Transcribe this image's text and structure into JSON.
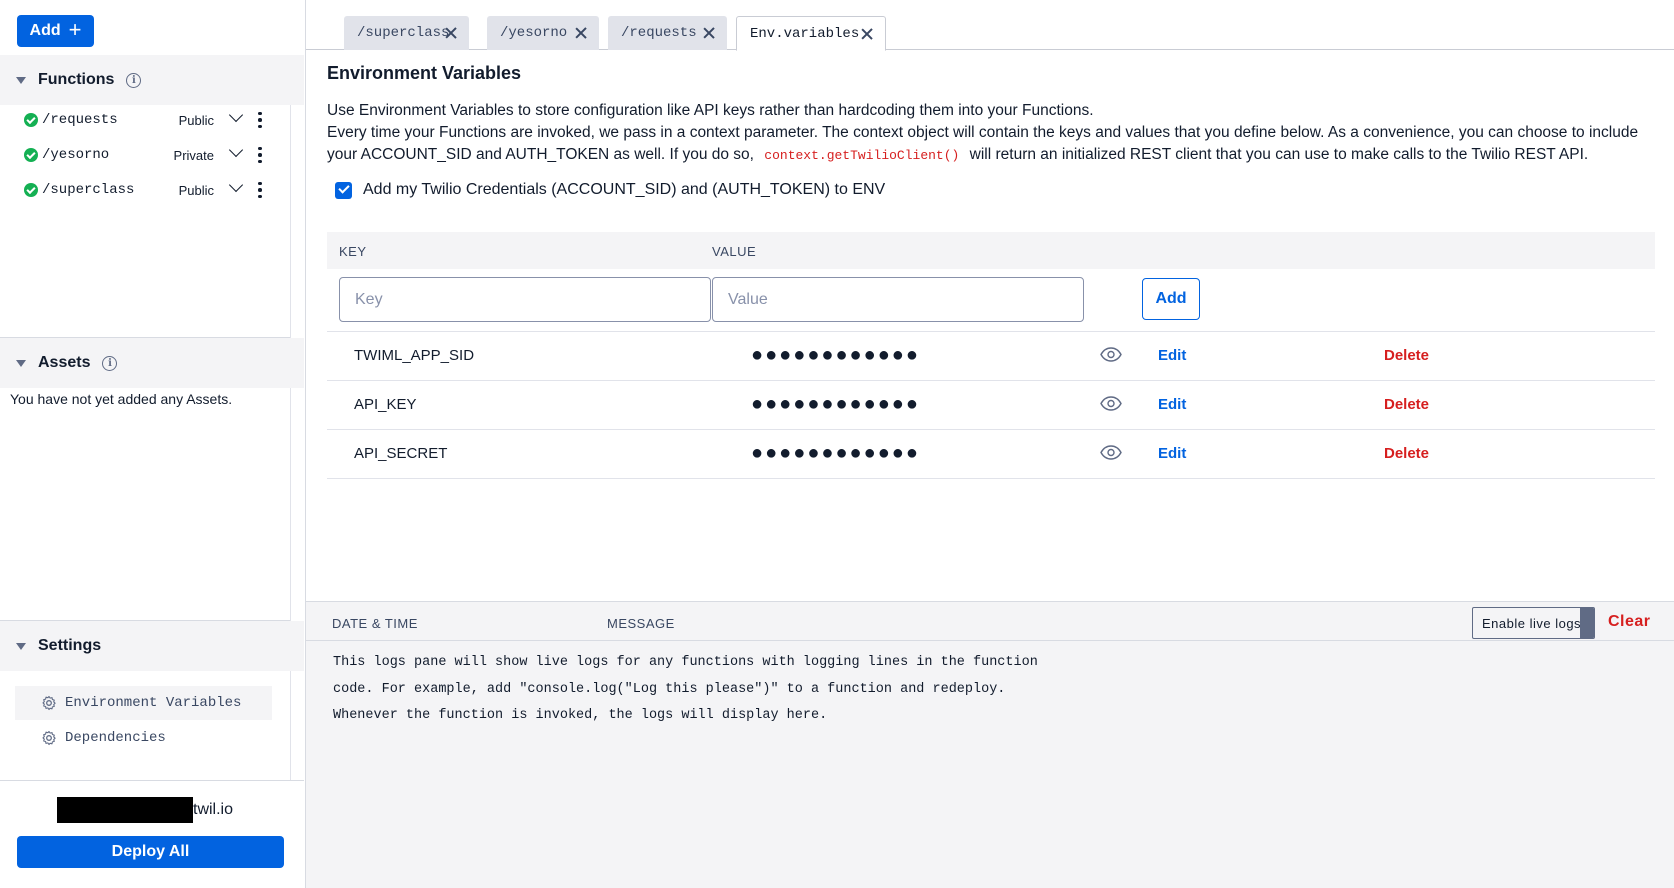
{
  "header": {
    "add_label": "Add"
  },
  "functions_section": {
    "title": "Functions",
    "items": [
      {
        "path": "/requests",
        "visibility": "Public"
      },
      {
        "path": "/yesorno",
        "visibility": "Private"
      },
      {
        "path": "/superclass",
        "visibility": "Public"
      }
    ]
  },
  "assets_section": {
    "title": "Assets",
    "empty_text": "You have not yet added any Assets."
  },
  "settings_section": {
    "title": "Settings",
    "items": [
      {
        "label": "Environment Variables",
        "active": true
      },
      {
        "label": "Dependencies",
        "active": false
      }
    ]
  },
  "footer": {
    "domain_suffix": "twil.io",
    "deploy_label": "Deploy All"
  },
  "tabs": [
    {
      "label": "/superclass",
      "active": false
    },
    {
      "label": "/yesorno",
      "active": false
    },
    {
      "label": "/requests",
      "active": false
    },
    {
      "label": "Env.variables",
      "active": true
    }
  ],
  "env": {
    "title": "Environment Variables",
    "desc_line1": "Use Environment Variables to store configuration like API keys rather than hardcoding them into your Functions.",
    "desc_line2_before": "Every time your Functions are invoked, we pass in a context parameter. The context object will contain the keys and values that you define below. As a convenience, you can choose to include your ACCOUNT_SID and AUTH_TOKEN as well. If you do so,",
    "desc_code": "context.getTwilioClient()",
    "desc_line2_after": "will return an initialized REST client that you can use to make calls to the Twilio REST API.",
    "credentials_label": "Add my Twilio Credentials (ACCOUNT_SID) and (AUTH_TOKEN) to ENV",
    "credentials_checked": true,
    "col_key": "KEY",
    "col_value": "VALUE",
    "key_placeholder": "Key",
    "value_placeholder": "Value",
    "add_label": "Add",
    "edit_label": "Edit",
    "delete_label": "Delete",
    "rows": [
      {
        "key": "TWIML_APP_SID",
        "value": "●●●●●●●●●●●●"
      },
      {
        "key": "API_KEY",
        "value": "●●●●●●●●●●●●"
      },
      {
        "key": "API_SECRET",
        "value": "●●●●●●●●●●●●"
      }
    ]
  },
  "logs": {
    "col_date": "DATE & TIME",
    "col_message": "MESSAGE",
    "live_label": "Enable live logs",
    "clear_label": "Clear",
    "message": "This logs pane will show live logs for any functions with logging lines in the function code. For example, add \"console.log(\"Log this please\")\" to a function and redeploy. Whenever the function is invoked, the logs will display here."
  },
  "colors": {
    "primary": "#0263e0",
    "danger": "#d61f1f",
    "success": "#14b053"
  }
}
